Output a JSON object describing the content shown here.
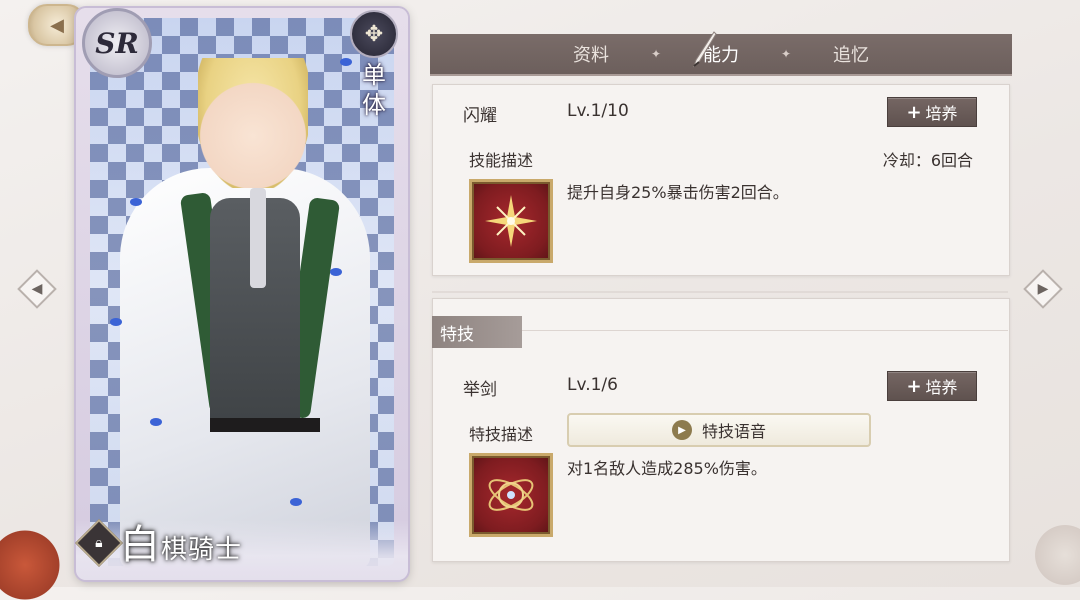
{
  "card": {
    "rarity": "SR",
    "type_label": "单体",
    "name_first": "白",
    "name_rest": "棋骑士"
  },
  "tabs": [
    {
      "label": "资料",
      "active": false
    },
    {
      "label": "能力",
      "active": true
    },
    {
      "label": "追忆",
      "active": false
    }
  ],
  "tab_separator": "✦",
  "skill": {
    "name": "闪耀",
    "level": "Lv.1/10",
    "upgrade_label": "培养",
    "desc_title": "技能描述",
    "cooldown": "冷却：6回合",
    "description": "提升自身25%暴击伤害2回合。",
    "icon": "sparkle-star-icon"
  },
  "special": {
    "section_title": "特技",
    "name": "举剑",
    "level": "Lv.1/6",
    "upgrade_label": "培养",
    "desc_title": "特技描述",
    "voice_label": "特技语音",
    "description": "对1名敌人造成285%伤害。",
    "icon": "orbit-sphere-icon"
  },
  "colors": {
    "tab_bar": "#6c5f5c",
    "upgrade_button": "#5f524f",
    "skill_icon_red": "#7e1c20",
    "icon_gold_border": "#c9a96b"
  }
}
